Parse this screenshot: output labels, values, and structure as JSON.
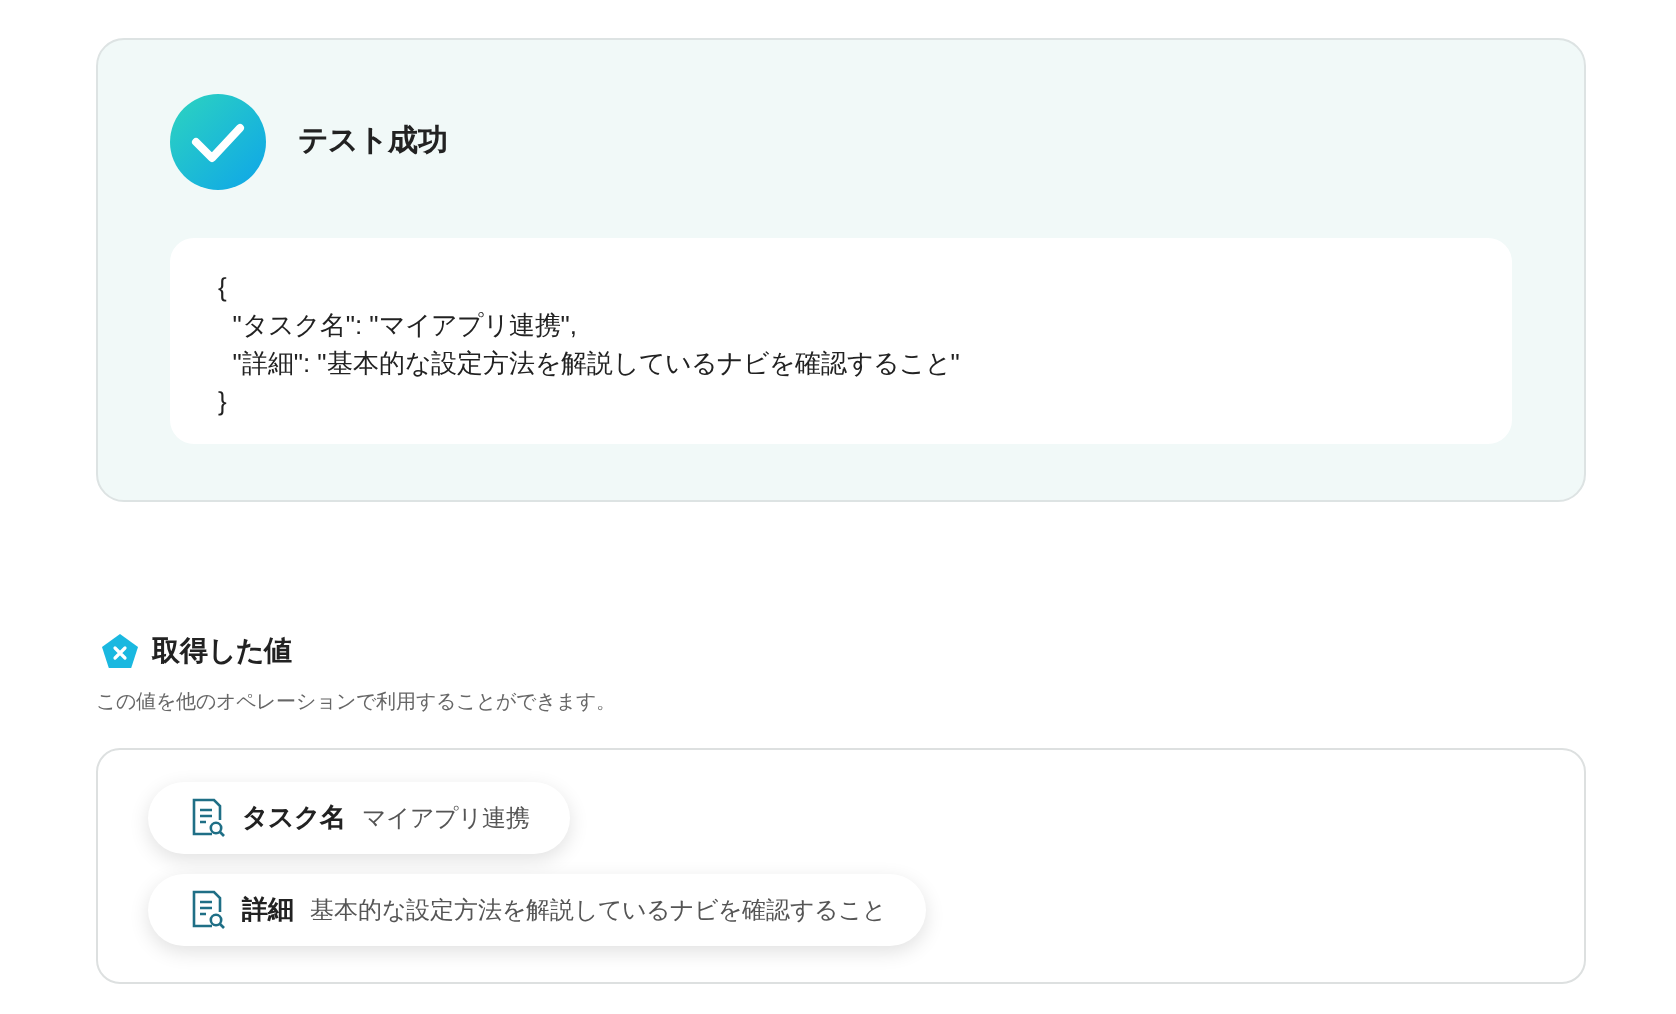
{
  "result": {
    "success": true,
    "title": "テスト成功",
    "code_lines": [
      "{",
      "  \"タスク名\": \"マイアプリ連携\",",
      "  \"詳細\": \"基本的な設定方法を解説しているナビを確認すること\"",
      "}"
    ]
  },
  "values": {
    "title": "取得した値",
    "description": "この値を他のオペレーションで利用することができます。",
    "items": [
      {
        "label": "タスク名",
        "value": "マイアプリ連携"
      },
      {
        "label": "詳細",
        "value": "基本的な設定方法を解説しているナビを確認すること"
      }
    ]
  }
}
